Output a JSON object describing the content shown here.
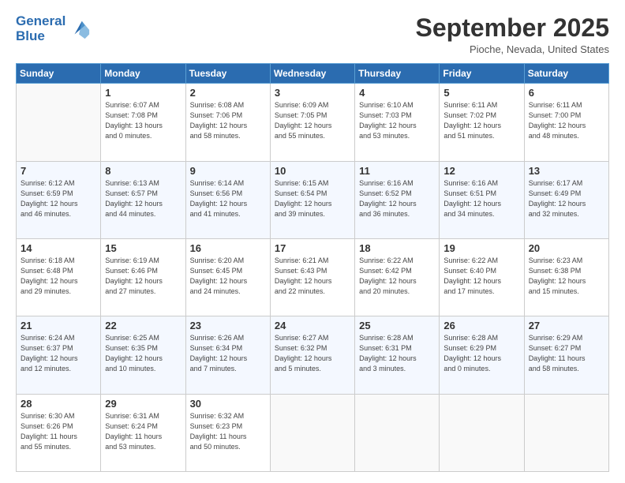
{
  "header": {
    "logo_line1": "General",
    "logo_line2": "Blue",
    "month": "September 2025",
    "location": "Pioche, Nevada, United States"
  },
  "weekdays": [
    "Sunday",
    "Monday",
    "Tuesday",
    "Wednesday",
    "Thursday",
    "Friday",
    "Saturday"
  ],
  "weeks": [
    [
      {
        "day": "",
        "info": ""
      },
      {
        "day": "1",
        "info": "Sunrise: 6:07 AM\nSunset: 7:08 PM\nDaylight: 13 hours\nand 0 minutes."
      },
      {
        "day": "2",
        "info": "Sunrise: 6:08 AM\nSunset: 7:06 PM\nDaylight: 12 hours\nand 58 minutes."
      },
      {
        "day": "3",
        "info": "Sunrise: 6:09 AM\nSunset: 7:05 PM\nDaylight: 12 hours\nand 55 minutes."
      },
      {
        "day": "4",
        "info": "Sunrise: 6:10 AM\nSunset: 7:03 PM\nDaylight: 12 hours\nand 53 minutes."
      },
      {
        "day": "5",
        "info": "Sunrise: 6:11 AM\nSunset: 7:02 PM\nDaylight: 12 hours\nand 51 minutes."
      },
      {
        "day": "6",
        "info": "Sunrise: 6:11 AM\nSunset: 7:00 PM\nDaylight: 12 hours\nand 48 minutes."
      }
    ],
    [
      {
        "day": "7",
        "info": "Sunrise: 6:12 AM\nSunset: 6:59 PM\nDaylight: 12 hours\nand 46 minutes."
      },
      {
        "day": "8",
        "info": "Sunrise: 6:13 AM\nSunset: 6:57 PM\nDaylight: 12 hours\nand 44 minutes."
      },
      {
        "day": "9",
        "info": "Sunrise: 6:14 AM\nSunset: 6:56 PM\nDaylight: 12 hours\nand 41 minutes."
      },
      {
        "day": "10",
        "info": "Sunrise: 6:15 AM\nSunset: 6:54 PM\nDaylight: 12 hours\nand 39 minutes."
      },
      {
        "day": "11",
        "info": "Sunrise: 6:16 AM\nSunset: 6:52 PM\nDaylight: 12 hours\nand 36 minutes."
      },
      {
        "day": "12",
        "info": "Sunrise: 6:16 AM\nSunset: 6:51 PM\nDaylight: 12 hours\nand 34 minutes."
      },
      {
        "day": "13",
        "info": "Sunrise: 6:17 AM\nSunset: 6:49 PM\nDaylight: 12 hours\nand 32 minutes."
      }
    ],
    [
      {
        "day": "14",
        "info": "Sunrise: 6:18 AM\nSunset: 6:48 PM\nDaylight: 12 hours\nand 29 minutes."
      },
      {
        "day": "15",
        "info": "Sunrise: 6:19 AM\nSunset: 6:46 PM\nDaylight: 12 hours\nand 27 minutes."
      },
      {
        "day": "16",
        "info": "Sunrise: 6:20 AM\nSunset: 6:45 PM\nDaylight: 12 hours\nand 24 minutes."
      },
      {
        "day": "17",
        "info": "Sunrise: 6:21 AM\nSunset: 6:43 PM\nDaylight: 12 hours\nand 22 minutes."
      },
      {
        "day": "18",
        "info": "Sunrise: 6:22 AM\nSunset: 6:42 PM\nDaylight: 12 hours\nand 20 minutes."
      },
      {
        "day": "19",
        "info": "Sunrise: 6:22 AM\nSunset: 6:40 PM\nDaylight: 12 hours\nand 17 minutes."
      },
      {
        "day": "20",
        "info": "Sunrise: 6:23 AM\nSunset: 6:38 PM\nDaylight: 12 hours\nand 15 minutes."
      }
    ],
    [
      {
        "day": "21",
        "info": "Sunrise: 6:24 AM\nSunset: 6:37 PM\nDaylight: 12 hours\nand 12 minutes."
      },
      {
        "day": "22",
        "info": "Sunrise: 6:25 AM\nSunset: 6:35 PM\nDaylight: 12 hours\nand 10 minutes."
      },
      {
        "day": "23",
        "info": "Sunrise: 6:26 AM\nSunset: 6:34 PM\nDaylight: 12 hours\nand 7 minutes."
      },
      {
        "day": "24",
        "info": "Sunrise: 6:27 AM\nSunset: 6:32 PM\nDaylight: 12 hours\nand 5 minutes."
      },
      {
        "day": "25",
        "info": "Sunrise: 6:28 AM\nSunset: 6:31 PM\nDaylight: 12 hours\nand 3 minutes."
      },
      {
        "day": "26",
        "info": "Sunrise: 6:28 AM\nSunset: 6:29 PM\nDaylight: 12 hours\nand 0 minutes."
      },
      {
        "day": "27",
        "info": "Sunrise: 6:29 AM\nSunset: 6:27 PM\nDaylight: 11 hours\nand 58 minutes."
      }
    ],
    [
      {
        "day": "28",
        "info": "Sunrise: 6:30 AM\nSunset: 6:26 PM\nDaylight: 11 hours\nand 55 minutes."
      },
      {
        "day": "29",
        "info": "Sunrise: 6:31 AM\nSunset: 6:24 PM\nDaylight: 11 hours\nand 53 minutes."
      },
      {
        "day": "30",
        "info": "Sunrise: 6:32 AM\nSunset: 6:23 PM\nDaylight: 11 hours\nand 50 minutes."
      },
      {
        "day": "",
        "info": ""
      },
      {
        "day": "",
        "info": ""
      },
      {
        "day": "",
        "info": ""
      },
      {
        "day": "",
        "info": ""
      }
    ]
  ]
}
